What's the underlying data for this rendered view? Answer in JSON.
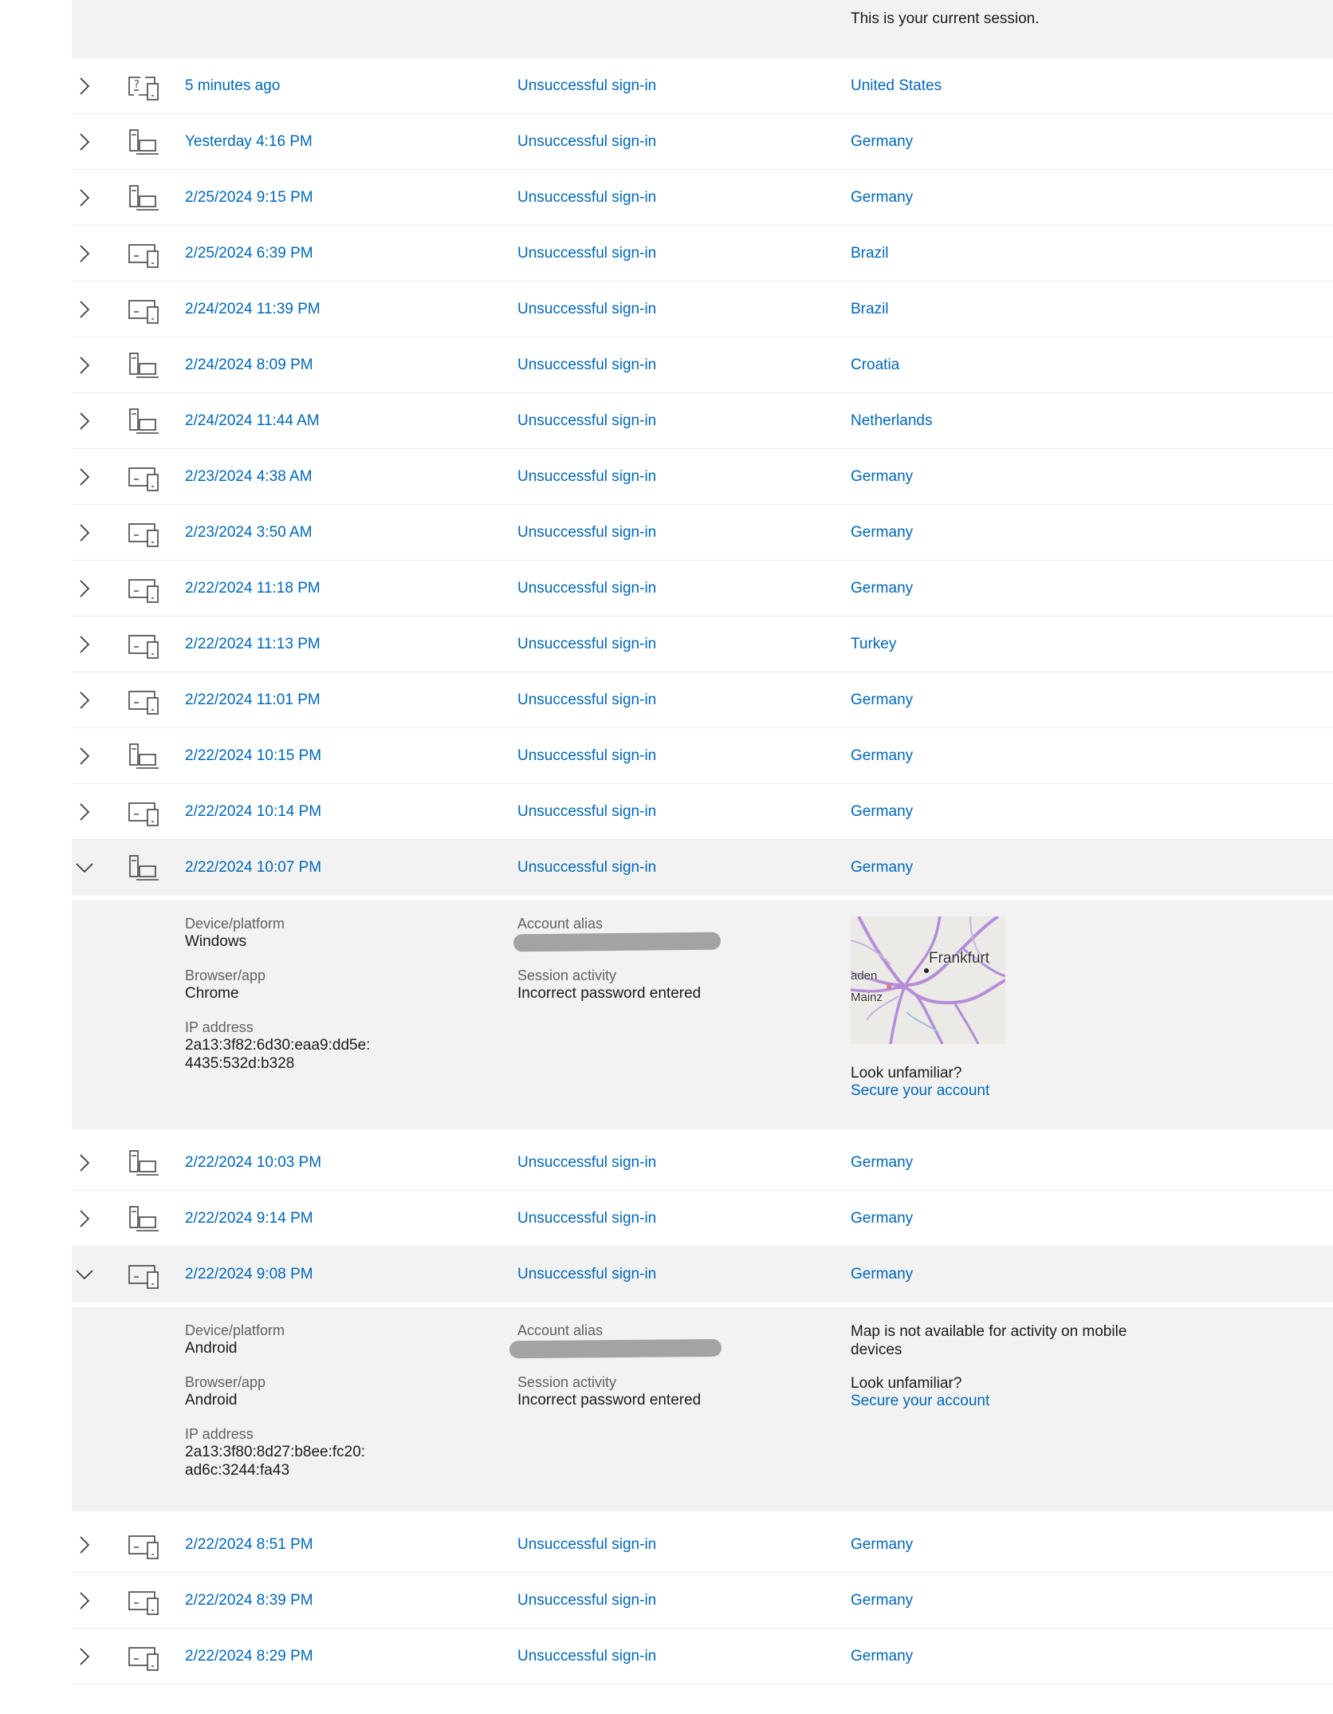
{
  "current_session_text": "This is your current session.",
  "rows_a": [
    {
      "date": "5 minutes ago",
      "status": "Unsuccessful sign-in",
      "location": "United States",
      "device_icon": "unknown-device-icon"
    },
    {
      "date": "Yesterday 4:16 PM",
      "status": "Unsuccessful sign-in",
      "location": "Germany",
      "device_icon": "desktop-computer-icon"
    },
    {
      "date": "2/25/2024 9:15 PM",
      "status": "Unsuccessful sign-in",
      "location": "Germany",
      "device_icon": "desktop-computer-icon"
    },
    {
      "date": "2/25/2024 6:39 PM",
      "status": "Unsuccessful sign-in",
      "location": "Brazil",
      "device_icon": "devices-icon"
    },
    {
      "date": "2/24/2024 11:39 PM",
      "status": "Unsuccessful sign-in",
      "location": "Brazil",
      "device_icon": "devices-icon"
    },
    {
      "date": "2/24/2024 8:09 PM",
      "status": "Unsuccessful sign-in",
      "location": "Croatia",
      "device_icon": "desktop-computer-icon"
    },
    {
      "date": "2/24/2024 11:44 AM",
      "status": "Unsuccessful sign-in",
      "location": "Netherlands",
      "device_icon": "desktop-computer-icon"
    },
    {
      "date": "2/23/2024 4:38 AM",
      "status": "Unsuccessful sign-in",
      "location": "Germany",
      "device_icon": "devices-icon"
    },
    {
      "date": "2/23/2024 3:50 AM",
      "status": "Unsuccessful sign-in",
      "location": "Germany",
      "device_icon": "devices-icon"
    },
    {
      "date": "2/22/2024 11:18 PM",
      "status": "Unsuccessful sign-in",
      "location": "Germany",
      "device_icon": "devices-icon"
    },
    {
      "date": "2/22/2024 11:13 PM",
      "status": "Unsuccessful sign-in",
      "location": "Turkey",
      "device_icon": "devices-icon"
    },
    {
      "date": "2/22/2024 11:01 PM",
      "status": "Unsuccessful sign-in",
      "location": "Germany",
      "device_icon": "devices-icon"
    },
    {
      "date": "2/22/2024 10:15 PM",
      "status": "Unsuccessful sign-in",
      "location": "Germany",
      "device_icon": "desktop-computer-icon"
    },
    {
      "date": "2/22/2024 10:14 PM",
      "status": "Unsuccessful sign-in",
      "location": "Germany",
      "device_icon": "devices-icon"
    }
  ],
  "expanded_1": {
    "row": {
      "date": "2/22/2024 10:07 PM",
      "status": "Unsuccessful sign-in",
      "location": "Germany",
      "device_icon": "desktop-computer-icon"
    },
    "device_label": "Device/platform",
    "device_value": "Windows",
    "browser_label": "Browser/app",
    "browser_value": "Chrome",
    "ip_label": "IP address",
    "ip_line1": "2a13:3f82:6d30:eaa9:dd5e:",
    "ip_line2": "4435:532d:b328",
    "alias_label": "Account alias",
    "session_label": "Session activity",
    "session_value": "Incorrect password entered",
    "map_city": "Frankfurt",
    "map_city2": "aden",
    "map_city3": "Mainz",
    "unfamiliar": "Look unfamiliar?",
    "secure_link": "Secure your account"
  },
  "rows_b": [
    {
      "date": "2/22/2024 10:03 PM",
      "status": "Unsuccessful sign-in",
      "location": "Germany",
      "device_icon": "desktop-computer-icon"
    },
    {
      "date": "2/22/2024 9:14 PM",
      "status": "Unsuccessful sign-in",
      "location": "Germany",
      "device_icon": "desktop-computer-icon"
    }
  ],
  "expanded_2": {
    "row": {
      "date": "2/22/2024 9:08 PM",
      "status": "Unsuccessful sign-in",
      "location": "Germany",
      "device_icon": "devices-icon"
    },
    "device_label": "Device/platform",
    "device_value": "Android",
    "browser_label": "Browser/app",
    "browser_value": "Android",
    "ip_label": "IP address",
    "ip_line1": "2a13:3f80:8d27:b8ee:fc20:",
    "ip_line2": "ad6c:3244:fa43",
    "alias_label": "Account alias",
    "session_label": "Session activity",
    "session_value": "Incorrect password entered",
    "map_note_line1": "Map is not available for activity on mobile",
    "map_note_line2": "devices",
    "unfamiliar": "Look unfamiliar?",
    "secure_link": "Secure your account"
  },
  "rows_c": [
    {
      "date": "2/22/2024 8:51 PM",
      "status": "Unsuccessful sign-in",
      "location": "Germany",
      "device_icon": "devices-icon"
    },
    {
      "date": "2/22/2024 8:39 PM",
      "status": "Unsuccessful sign-in",
      "location": "Germany",
      "device_icon": "devices-icon"
    },
    {
      "date": "2/22/2024 8:29 PM",
      "status": "Unsuccessful sign-in",
      "location": "Germany",
      "device_icon": "devices-icon"
    }
  ],
  "colors": {
    "link": "#0067b8",
    "panel": "#f2f2f2",
    "divider": "#ececec",
    "redaction": "#9e9e9e"
  }
}
